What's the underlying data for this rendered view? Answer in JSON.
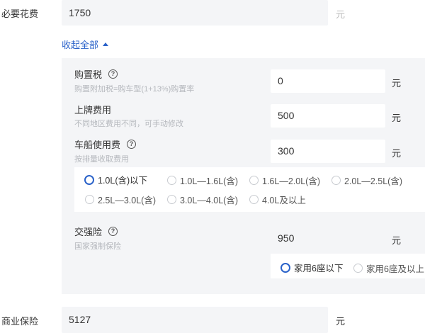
{
  "necessary": {
    "label": "必要花费",
    "value": "1750",
    "unit": "元"
  },
  "collapse": {
    "label": "收起全部"
  },
  "purchase_tax": {
    "title": "购置税",
    "help": "?",
    "sub": "购置附加税=购车型(1+13%)购置率",
    "value": "0",
    "unit": "元"
  },
  "license": {
    "title": "上牌费用",
    "sub": "不同地区费用不同，可手动修改",
    "value": "500",
    "unit": "元"
  },
  "vehicle_tax": {
    "title": "车船使用费",
    "help": "?",
    "sub": "按排量收取费用",
    "value": "300",
    "unit": "元",
    "options": [
      "1.0L(含)以下",
      "1.0L—1.6L(含)",
      "1.6L—2.0L(含)",
      "2.0L—2.5L(含)",
      "2.5L—3.0L(含)",
      "3.0L—4.0L(含)",
      "4.0L及以上"
    ],
    "selected": "1.0L(含)以下"
  },
  "compulsory": {
    "title": "交强险",
    "help": "?",
    "sub": "国家强制保险",
    "value": "950",
    "unit": "元",
    "options": [
      "家用6座以下",
      "家用6座及以上"
    ],
    "selected": "家用6座以下"
  },
  "commercial": {
    "label": "商业保险",
    "value": "5127",
    "unit": "元"
  },
  "colors": {
    "accent": "#2a62c9",
    "panel": "#f4f5f7",
    "subtext": "#b5b8bd"
  }
}
